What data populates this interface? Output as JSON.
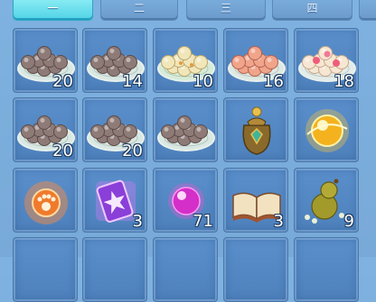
{
  "tabs": [
    {
      "label": "一",
      "active": true
    },
    {
      "label": "二",
      "active": false
    },
    {
      "label": "三",
      "active": false
    },
    {
      "label": "四",
      "active": false
    },
    {
      "label": "",
      "active": false
    }
  ],
  "items": [
    {
      "name": "grey-rice-balls-plate",
      "count": "20",
      "icon": "plate-grey-balls-icon"
    },
    {
      "name": "grey-rice-balls-plate",
      "count": "14",
      "icon": "plate-grey-balls-icon"
    },
    {
      "name": "cream-dumplings-plate",
      "count": "10",
      "icon": "plate-cream-dumplings-icon"
    },
    {
      "name": "pink-dumplings-plate",
      "count": "16",
      "icon": "plate-pink-dumplings-icon"
    },
    {
      "name": "flower-cakes-plate",
      "count": "18",
      "icon": "plate-flower-cakes-icon"
    },
    {
      "name": "grey-rice-balls-plate",
      "count": "20",
      "icon": "plate-grey-balls-icon"
    },
    {
      "name": "grey-rice-balls-plate",
      "count": "20",
      "icon": "plate-grey-balls-icon"
    },
    {
      "name": "grey-rice-balls-plate",
      "count": "",
      "icon": "plate-grey-balls-icon"
    },
    {
      "name": "treasure-pouch",
      "count": "",
      "icon": "treasure-pouch-icon"
    },
    {
      "name": "golden-orb",
      "count": "",
      "icon": "golden-orb-icon"
    },
    {
      "name": "paw-emblem",
      "count": "",
      "icon": "paw-emblem-icon"
    },
    {
      "name": "purple-star-card",
      "count": "3",
      "icon": "purple-card-icon"
    },
    {
      "name": "magenta-pearl",
      "count": "71",
      "icon": "magenta-pearl-icon"
    },
    {
      "name": "open-book",
      "count": "3",
      "icon": "open-book-icon"
    },
    {
      "name": "gourd-with-pills",
      "count": "9",
      "icon": "gourd-icon"
    },
    {
      "name": "empty-slot",
      "count": "",
      "icon": ""
    },
    {
      "name": "empty-slot",
      "count": "",
      "icon": ""
    },
    {
      "name": "empty-slot",
      "count": "",
      "icon": ""
    },
    {
      "name": "empty-slot",
      "count": "",
      "icon": ""
    },
    {
      "name": "empty-slot",
      "count": "",
      "icon": ""
    }
  ]
}
